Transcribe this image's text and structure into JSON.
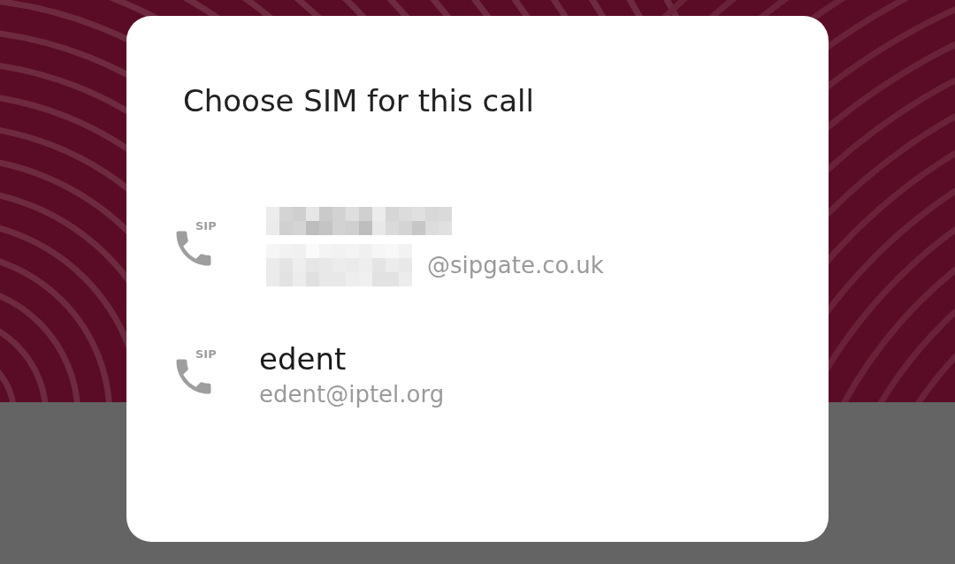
{
  "dialog": {
    "title": "Choose SIM for this call",
    "accounts": [
      {
        "badge": "SIP",
        "redacted": true,
        "address": "@sipgate.co.uk"
      },
      {
        "badge": "SIP",
        "redacted": false,
        "name": "edent",
        "address": "edent@iptel.org"
      }
    ]
  }
}
